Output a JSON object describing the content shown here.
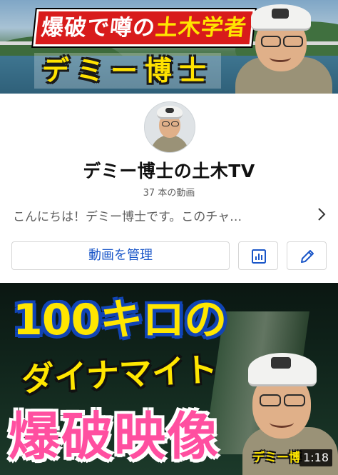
{
  "banner": {
    "title_line1_red": "爆破で噂の",
    "title_line1_yellow": "土木学者",
    "title_line2": "デミー博士"
  },
  "channel": {
    "name": "デミー博士の土木TV",
    "video_count": "37 本の動画",
    "description": "こんにちは！デミー博士です。このチャ…",
    "manage_button": "動画を管理",
    "analytics_icon": "bar-chart-icon",
    "edit_icon": "pencil-icon"
  },
  "video": {
    "line1": "100キロの",
    "line2": "ダイナマイト",
    "line3": "爆破映像",
    "badge": "デミー博",
    "duration": "1:18"
  },
  "colors": {
    "accent_blue": "#1a56c8",
    "banner_red": "#d81b1b",
    "thumb_yellow": "#ffe600",
    "thumb_pink": "#ff4fa0"
  }
}
